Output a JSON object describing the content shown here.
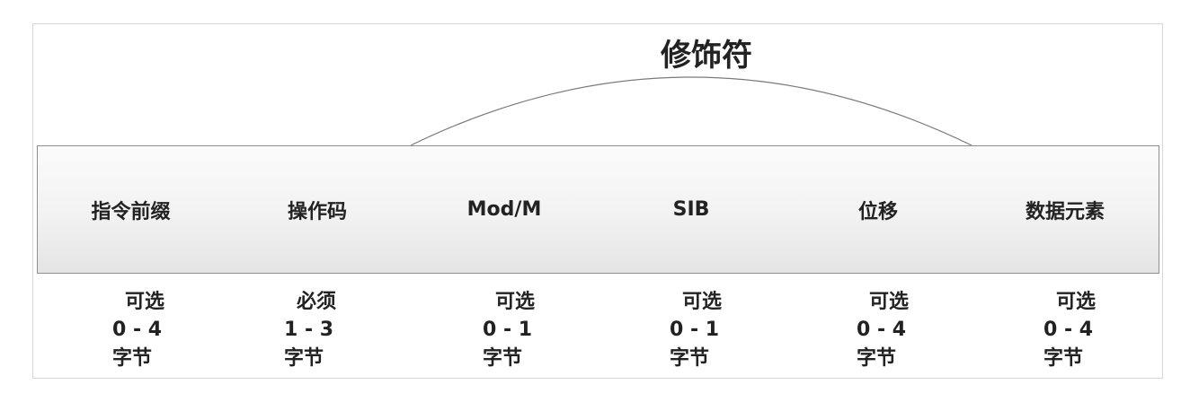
{
  "diagram": {
    "modifier_label": "修饰符",
    "fields": [
      {
        "label": "指令前缀",
        "requirement": "可选",
        "range": "0 - 4",
        "unit": "字节"
      },
      {
        "label": "操作码",
        "requirement": "必须",
        "range": "1 - 3",
        "unit": "字节"
      },
      {
        "label": "Mod/M",
        "requirement": "可选",
        "range": "0 - 1",
        "unit": "字节"
      },
      {
        "label": "SIB",
        "requirement": "可选",
        "range": "0 - 1",
        "unit": "字节"
      },
      {
        "label": "位移",
        "requirement": "可选",
        "range": "0 - 4",
        "unit": "字节"
      },
      {
        "label": "数据元素",
        "requirement": "可选",
        "range": "0 - 4",
        "unit": "字节"
      }
    ]
  }
}
